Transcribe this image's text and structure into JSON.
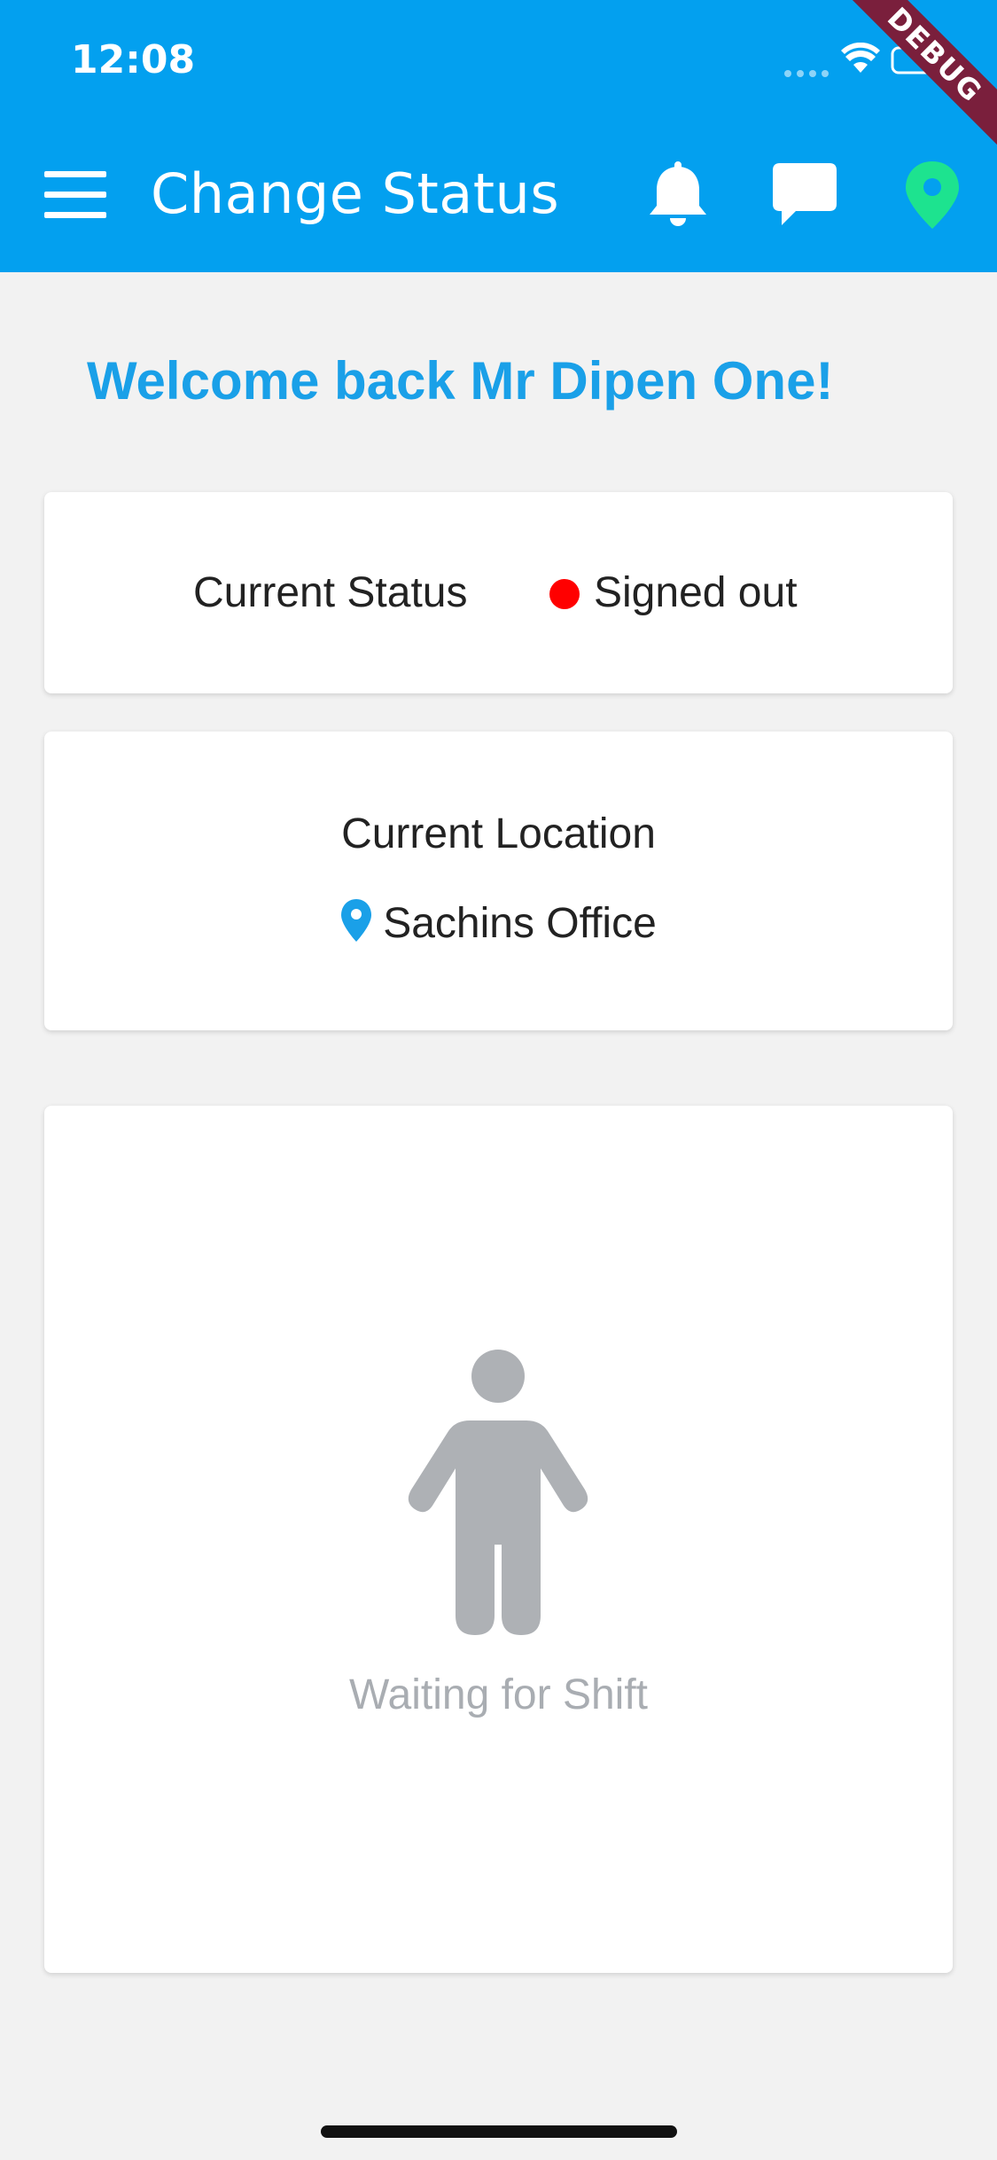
{
  "status_bar": {
    "time": "12:08"
  },
  "debug_banner": "DEBUG",
  "app_bar": {
    "title": "Change Status",
    "actions": [
      "bell-icon",
      "chat-icon",
      "location-pin-icon"
    ],
    "location_icon_color": "#1de38f",
    "background_color": "#03a0ef"
  },
  "welcome_message": "Welcome back Mr Dipen One!",
  "status_card": {
    "label": "Current Status",
    "value": "Signed out",
    "indicator_color": "#ff0000"
  },
  "location_card": {
    "label": "Current Location",
    "location": "Sachins Office",
    "pin_color": "#1aa0e8"
  },
  "shift_card": {
    "message": "Waiting for Shift",
    "icon": "person-icon",
    "icon_color": "#aeb1b5"
  }
}
